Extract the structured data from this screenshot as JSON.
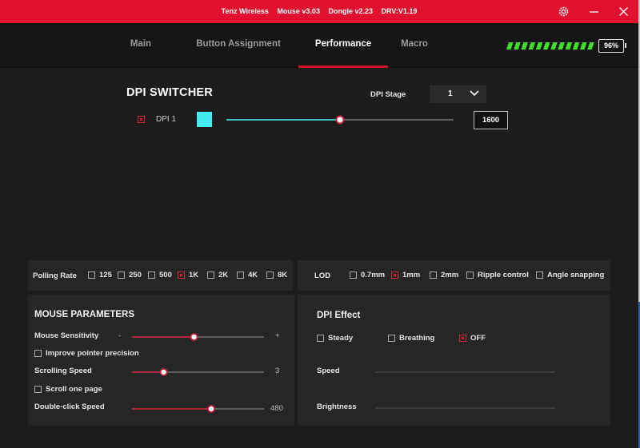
{
  "titlebar": {
    "product": "Tenz Wireless",
    "mouse_version": "Mouse v3.03",
    "dongle_version": "Dongle v2.23",
    "driver_version": "DRV:V1.19",
    "icons": [
      "gear-icon",
      "minimize-icon",
      "close-icon"
    ]
  },
  "nav": {
    "tabs": [
      {
        "label": "Main",
        "active": false
      },
      {
        "label": "Button Assignment",
        "active": false
      },
      {
        "label": "Performance",
        "active": true
      },
      {
        "label": "Macro",
        "active": false
      }
    ],
    "battery": {
      "percent_label": "96%",
      "level": 0.96,
      "color": "#3ee02a"
    }
  },
  "dpi_switcher": {
    "title": "DPI SWITCHER",
    "stage_label": "DPI Stage",
    "stage_value": "1",
    "stages": [
      {
        "label": "DPI 1",
        "checked": true,
        "color": "#46eaf2",
        "value": "1600",
        "slider_fraction": 0.5
      }
    ]
  },
  "polling_rate": {
    "label": "Polling Rate",
    "options": [
      {
        "label": "125",
        "checked": false
      },
      {
        "label": "250",
        "checked": false
      },
      {
        "label": "500",
        "checked": false
      },
      {
        "label": "1K",
        "checked": true
      },
      {
        "label": "2K",
        "checked": false
      },
      {
        "label": "4K",
        "checked": false
      },
      {
        "label": "8K",
        "checked": false
      }
    ]
  },
  "lod": {
    "label": "LOD",
    "options": [
      {
        "label": "0.7mm",
        "checked": false
      },
      {
        "label": "1mm",
        "checked": true
      },
      {
        "label": "2mm",
        "checked": false
      }
    ],
    "ripple_label": "Ripple control",
    "angle_label": "Angle snapping"
  },
  "mouse_parameters": {
    "title": "MOUSE PARAMETERS",
    "sensitivity_label": "Mouse Sensitivity",
    "sensitivity_minus": "-",
    "sensitivity_plus": "+",
    "sensitivity_fraction": 0.47,
    "precision_label": "Improve pointer precision",
    "scroll_label": "Scrolling Speed",
    "scroll_value": "3",
    "scroll_fraction": 0.24,
    "scroll_page_label": "Scroll one page",
    "dblclick_label": "Double-click Speed",
    "dblclick_value": "480",
    "dblclick_fraction": 0.6
  },
  "dpi_effect": {
    "title": "DPI Effect",
    "modes": [
      {
        "label": "Steady",
        "checked": false
      },
      {
        "label": "Breathing",
        "checked": false
      },
      {
        "label": "OFF",
        "checked": true
      }
    ],
    "speed_label": "Speed",
    "brightness_label": "Brightness"
  },
  "colors": {
    "accent": "#e0102e",
    "slider_fill_dpi": "#46eaf2",
    "slider_fill": "#d0243a"
  }
}
